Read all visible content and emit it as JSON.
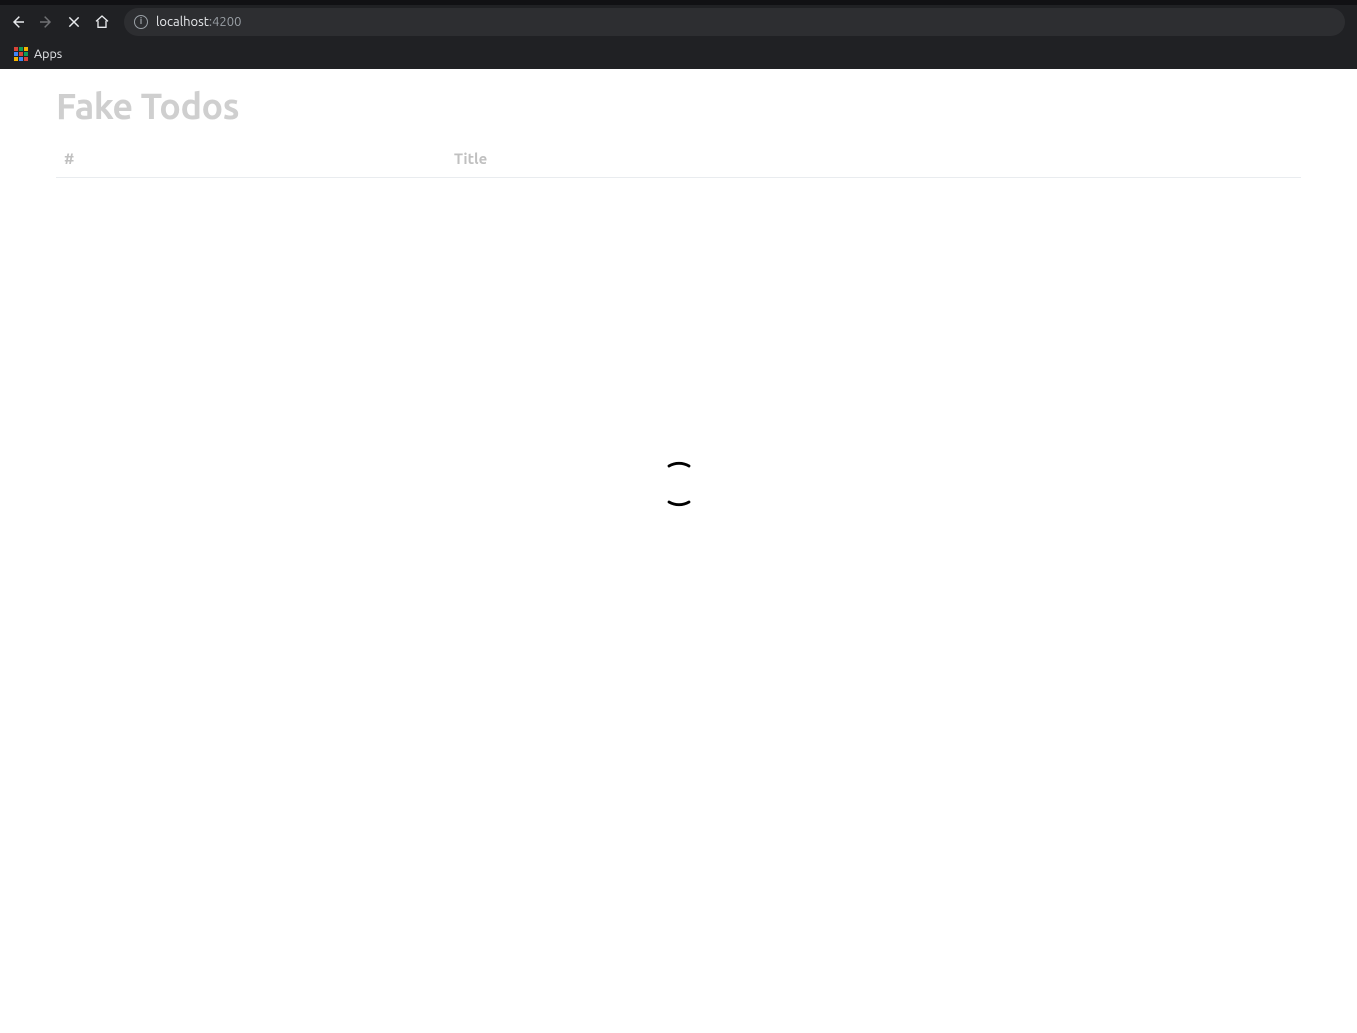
{
  "browser": {
    "url_host": "localhost",
    "url_port": ":4200",
    "apps_label": "Apps"
  },
  "page": {
    "title": "Fake Todos",
    "columns": {
      "hash": "#",
      "title": "Title"
    }
  }
}
